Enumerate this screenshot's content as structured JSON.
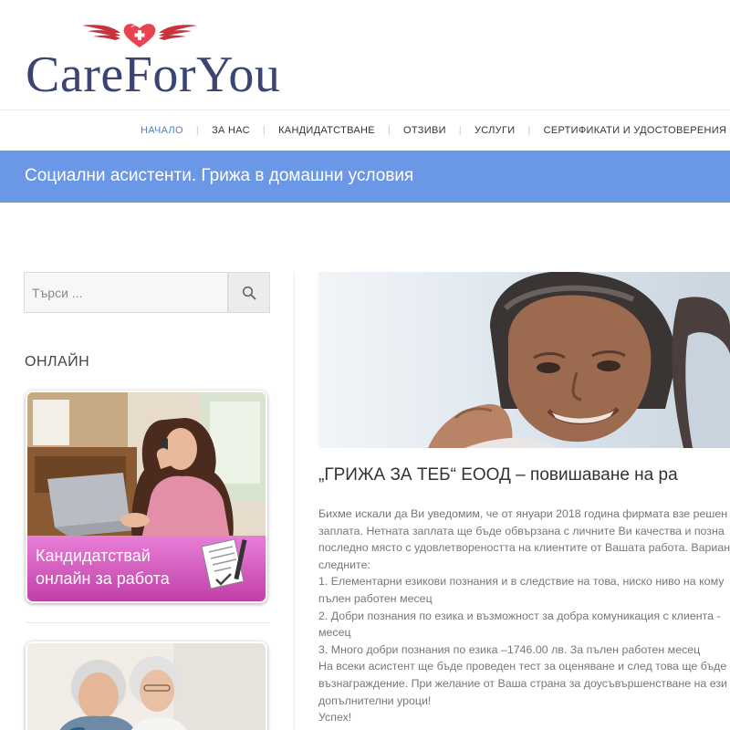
{
  "site": {
    "logo_text": "CareForYou",
    "accent": "#6a98e6",
    "logo_color": "#3b4472",
    "heart_color": "#e8434f"
  },
  "nav": {
    "items": [
      {
        "label": "НАЧАЛО",
        "active": true
      },
      {
        "label": "ЗА НАС"
      },
      {
        "label": "КАНДИДАТСТВАНЕ"
      },
      {
        "label": "ОТЗИВИ"
      },
      {
        "label": "УСЛУГИ"
      },
      {
        "label": "СЕРТИФИКАТИ И УДОСТОВЕРЕНИЯ"
      }
    ]
  },
  "banner": {
    "title": "Социални асистенти. Грижа в домашни условия"
  },
  "sidebar": {
    "search": {
      "placeholder": "Търси ...",
      "icon": "search-icon"
    },
    "widget_title": "ОНЛАЙН",
    "promo_apply": {
      "line1": "Кандидатствай",
      "line2": "онлайн за работа"
    }
  },
  "post": {
    "title": "„ГРИЖА ЗА ТЕБ“ ЕООД –  повишаване на ра",
    "lines": [
      "Бихме искали да Ви уведомим, че от януари 2018 година фирмата взе решен",
      "заплата. Нетната заплата ще бъде обвързана с личните Ви качества и позна",
      "последно място с удовлетвореността на клиентите от Вашата работа. Вариан",
      "следните:",
      "1. Елементарни езикови познания и в следствие на това, ниско ниво на кому",
      "пълен работен месец",
      "2. Добри познания по езика и възможност за добра комуникация с клиента -",
      "месец",
      "3. Много добри познания по езика –1746.00 лв. За пълен работен месец",
      "На всеки асистент ще бъде проведен тест за оценяване и след това ще бъде",
      "възнаграждение. При желание от Ваша страна за доусъвършенстване на ези",
      "допълнителни уроци!",
      "Успех!"
    ]
  }
}
